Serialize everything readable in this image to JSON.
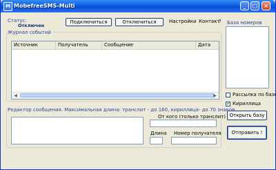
{
  "window": {
    "title": "MobefreeSMS-Multi"
  },
  "titlebar": {
    "minimize_glyph": "_",
    "maximize_glyph": "□",
    "close_glyph": "×",
    "app_icon_glyph": "M"
  },
  "status": {
    "label": "Статус:",
    "value": "Отключен"
  },
  "toolbar": {
    "connect_label": "Подключиться",
    "disconnect_label": "Отключиться",
    "settings_label": "Настройки",
    "contact_label": "Контакт",
    "help_label": "?"
  },
  "journal": {
    "title": "Журнал событий",
    "columns": [
      "Источник",
      "Получатель",
      "Сообщение",
      "Дата"
    ]
  },
  "editor": {
    "title": "Редактор сообщения. Максимальная длина: транслит - до 160,  кириллица- до 70 знаков.",
    "message_value": "",
    "sender_label": "От кого (только транслит)",
    "sender_value": "",
    "length_label": "Длина",
    "length_value": "",
    "recipient_label": "Номер получателя",
    "recipient_value": ""
  },
  "numbers_db": {
    "title": "База номеров",
    "bulk_label": "Рассылка по базе",
    "bulk_checked": false,
    "cyrillic_label": "Кириллица",
    "cyrillic_checked": true,
    "cyrillic_check_glyph": "✔",
    "open_label": "Открыть базу",
    "send_label": "Отправить !"
  }
}
